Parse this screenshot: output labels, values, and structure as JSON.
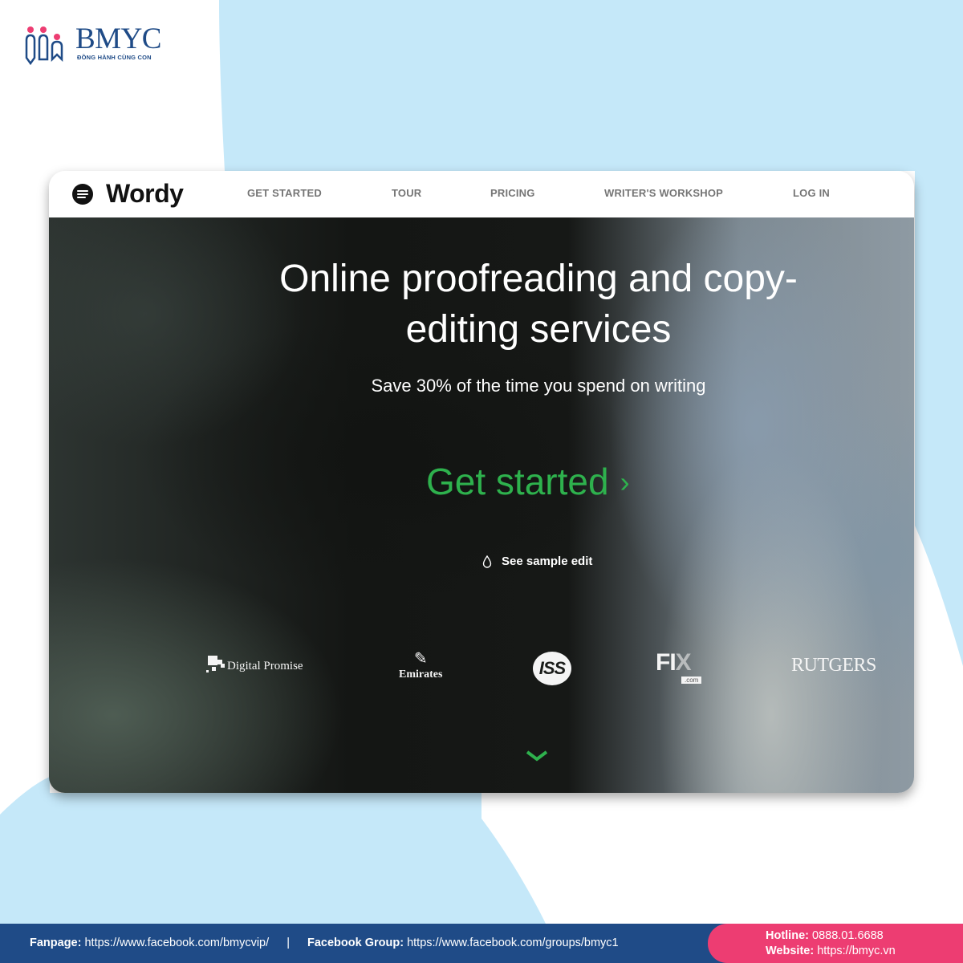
{
  "brand": {
    "name": "BMYC",
    "tagline": "ĐỒNG HÀNH CÙNG CON",
    "primary_color": "#1f4b87",
    "accent_color": "#ed3d72",
    "background_blob_color": "#c5e8f9"
  },
  "wordy": {
    "logo_icon": "menu-circle-icon",
    "logo_text": "Wordy",
    "nav": [
      {
        "label": "GET STARTED"
      },
      {
        "label": "TOUR"
      },
      {
        "label": "PRICING"
      },
      {
        "label": "WRITER'S WORKSHOP"
      },
      {
        "label": "LOG IN"
      }
    ],
    "hero": {
      "headline_line1": "Online proofreading and copy-",
      "headline_line2": "editing services",
      "subheadline": "Save 30% of the time you spend on writing",
      "cta_label": "Get started",
      "cta_chevron": "›",
      "cta_color": "#2eb14d",
      "sample_icon": "drop-icon",
      "sample_label": "See sample edit",
      "scroll_icon": "chevron-down-icon"
    },
    "client_logos": [
      {
        "name": "Digital Promise"
      },
      {
        "name": "Emirates"
      },
      {
        "name": "ISS"
      },
      {
        "name": "FIX",
        "suffix": ".com"
      },
      {
        "name": "RUTGERS"
      }
    ]
  },
  "footer": {
    "fanpage_label": "Fanpage:",
    "fanpage_url": "https://www.facebook.com/bmycvip/",
    "separator": "|",
    "group_label": "Facebook Group:",
    "group_url": "https://www.facebook.com/groups/bmyc1",
    "hotline_label": "Hotline:",
    "hotline_value": "0888.01.6688",
    "website_label": "Website:",
    "website_value": "https://bmyc.vn"
  }
}
